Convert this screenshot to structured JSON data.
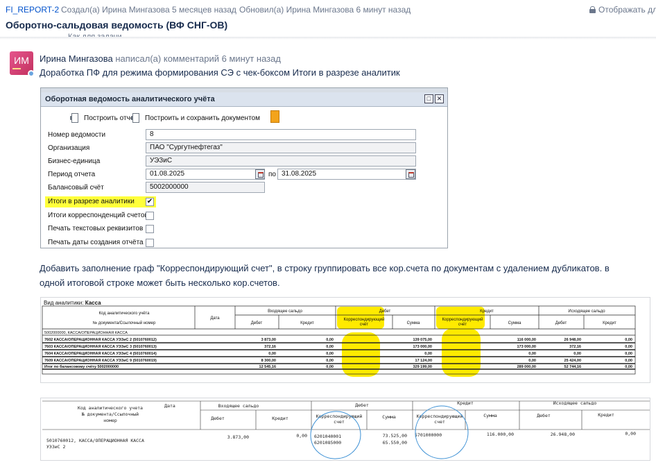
{
  "header": {
    "issue_key": "FI_REPORT-2",
    "created": "Создал(а) Ирина Мингазова 5 месяцев назад",
    "updated": "Обновил(а) Ирина Мингазова 6 минут назад",
    "restriction": "Отображать для",
    "title": "Оборотно-сальдовая ведомость (ВФ СНГ-ОВ)",
    "cut_text": "Как для задачи"
  },
  "comment": {
    "avatar_initials": "ИМ",
    "author": "Ирина Мингазова",
    "meta": "написал(а) комментарий 6 минут назад",
    "text": "Доработка ПФ для режима формирования СЭ с чек-боксом Итоги в разрезе аналитик",
    "paragraph_line1": "Добавить заполнение граф \"Корреспондирующий счет\", в строку группировать все кор.счета по документам с удалением дубликатов. в",
    "paragraph_line2": "одной итоговой строке может быть несколько кор.счетов."
  },
  "dialog": {
    "title": "Оборотная ведомость аналитического учёта",
    "btn_build": "Построить отчет",
    "btn_build_save": "Построить и сохранить документом",
    "fields": [
      {
        "label": "Номер ведомости",
        "value": "8"
      },
      {
        "label": "Организация",
        "value": "ПАО \"Сургутнефтегаз\""
      },
      {
        "label": "Бизнес-единица",
        "value": "УЭЗиС"
      },
      {
        "label": "Период отчета",
        "value": "01.08.2025"
      },
      {
        "label": "Балансовый счёт",
        "value": "5002000000"
      }
    ],
    "period_to_label": "по",
    "period_to_value": "31.08.2025",
    "checkboxes": [
      {
        "label": "Итоги в разрезе аналитики",
        "checked": "✔"
      },
      {
        "label": "Итоги корреспонденций счетов",
        "checked": ""
      },
      {
        "label": "Печать текстовых реквизитов",
        "checked": ""
      },
      {
        "label": "Печать даты создания отчёта",
        "checked": ""
      }
    ]
  },
  "table1": {
    "title_prefix": "Вид аналитики:",
    "title_value": "Касса",
    "h_code_1": "Код аналитического учёта",
    "h_code_2": "№ документа/Ссылочный номер",
    "h_date": "Дата",
    "h_opening": "Входящее сальдо",
    "h_debit": "Дебет",
    "h_credit": "Кредит",
    "h_closing": "Исходящее сальдо",
    "h_sub_debit": "Дебет",
    "h_sub_credit": "Кредит",
    "h_corr_1": "Корреспондирующий",
    "h_corr_2": "счёт",
    "h_sum": "Сумма",
    "group_row": "5002000000, КАССА/ОПЕРАЦИОННАЯ КАССА",
    "rows": [
      {
        "name": "7602 КАССА/ОПЕРАЦИОННАЯ КАССА УЭЗиС 2 (5010760012)",
        "in_d": "3 873,00",
        "in_c": "0,00",
        "deb_sum": "139 075,00",
        "cred_sum": "116 000,00",
        "out_d": "26 948,00",
        "out_c": "0,00"
      },
      {
        "name": "7603 КАССА/ОПЕРАЦИОННАЯ КАССА УЭЗиС 3 (5010760013)",
        "in_d": "372,16",
        "in_c": "0,00",
        "deb_sum": "173 000,00",
        "cred_sum": "173 000,00",
        "out_d": "372,16",
        "out_c": "0,00"
      },
      {
        "name": "7604 КАССА/ОПЕРАЦИОННАЯ КАССА УЭЗиС 4 (5010760014)",
        "in_d": "0,00",
        "in_c": "0,00",
        "deb_sum": "0,00",
        "cred_sum": "0,00",
        "out_d": "0,00",
        "out_c": "0,00"
      },
      {
        "name": "7609 КАССА/ОПЕРАЦИОННАЯ КАССА УЭЗиС 9 (5010760019)",
        "in_d": "8 300,00",
        "in_c": "0,00",
        "deb_sum": "17 124,00",
        "cred_sum": "0,00",
        "out_d": "25 424,00",
        "out_c": "0,00"
      }
    ],
    "total": {
      "name": "Итог по балансовому счёту 5002000000",
      "in_d": "12 545,16",
      "in_c": "0,00",
      "deb_sum": "329 199,00",
      "cred_sum": "289 000,00",
      "out_d": "52 744,16",
      "out_c": "0,00"
    }
  },
  "table2": {
    "h_code_1": "Код аналитического учета",
    "h_code_2": "№ документа/Ссылочный",
    "h_code_3": "номер",
    "h_date": "Дата",
    "h_opening": "Входящее сальдо",
    "h_debit": "Дебет",
    "h_credit": "Кредит",
    "h_closing": "Исходящее сальдо",
    "h_sub_debit": "Дебет",
    "h_sub_credit": "Кредит",
    "h_corr_1": "Корреспондирующий",
    "h_corr_2": "счет",
    "h_sum": "Сумма",
    "row_name_1": "5010760012, КАССА/ОПЕРАЦИОННАЯ КАССА",
    "row_name_2": "УЭЗиС 2",
    "in_d": "3.873,00",
    "in_c": "0,00",
    "deb_corr_1": "6201040001",
    "deb_corr_2": "6201085000",
    "deb_sum_1": "73.525,00",
    "deb_sum_2": "65.550,00",
    "cred_corr": "5701000000",
    "cred_sum": "116.000,00",
    "out_d": "26.948,00",
    "out_c": "0,00"
  }
}
